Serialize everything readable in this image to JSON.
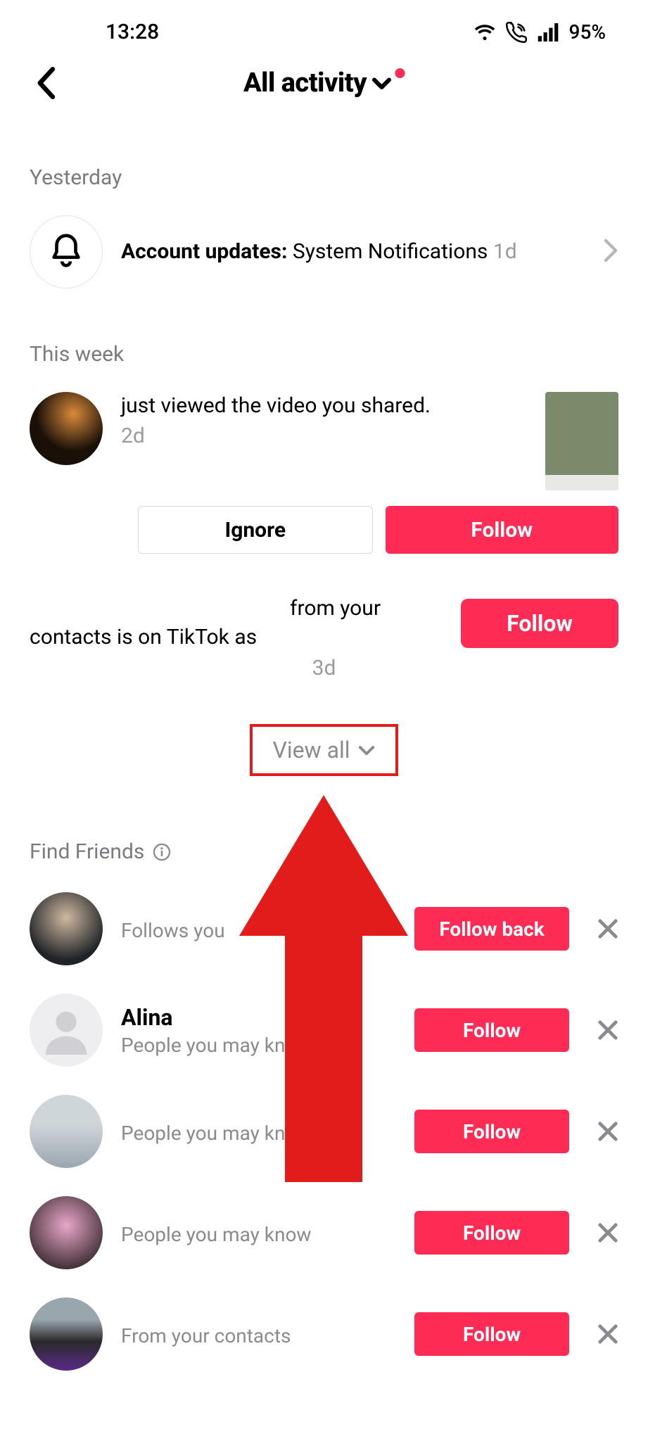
{
  "status_bar": {
    "time": "13:28",
    "battery": "95%"
  },
  "header": {
    "title": "All activity"
  },
  "sections": {
    "yesterday": "Yesterday",
    "this_week": "This week",
    "find_friends": "Find Friends"
  },
  "account_updates": {
    "label": "Account updates:",
    "text": "System Notifications",
    "time": "1d"
  },
  "activity": {
    "viewed": {
      "text": "just viewed the video you shared.",
      "time": "2d",
      "ignore_label": "Ignore",
      "follow_label": "Follow"
    },
    "contact": {
      "line1": "from your",
      "line2": "contacts is on TikTok as",
      "time": "3d",
      "follow_label": "Follow"
    }
  },
  "view_all_label": "View all",
  "friends": [
    {
      "name": "",
      "sub": "Follows you",
      "button": "Follow back"
    },
    {
      "name": "Alina",
      "sub": "People you may know",
      "button": "Follow"
    },
    {
      "name": "",
      "sub": "People you may know",
      "button": "Follow"
    },
    {
      "name": "",
      "sub": "People you may know",
      "button": "Follow"
    },
    {
      "name": "",
      "sub": "From your contacts",
      "button": "Follow"
    }
  ]
}
